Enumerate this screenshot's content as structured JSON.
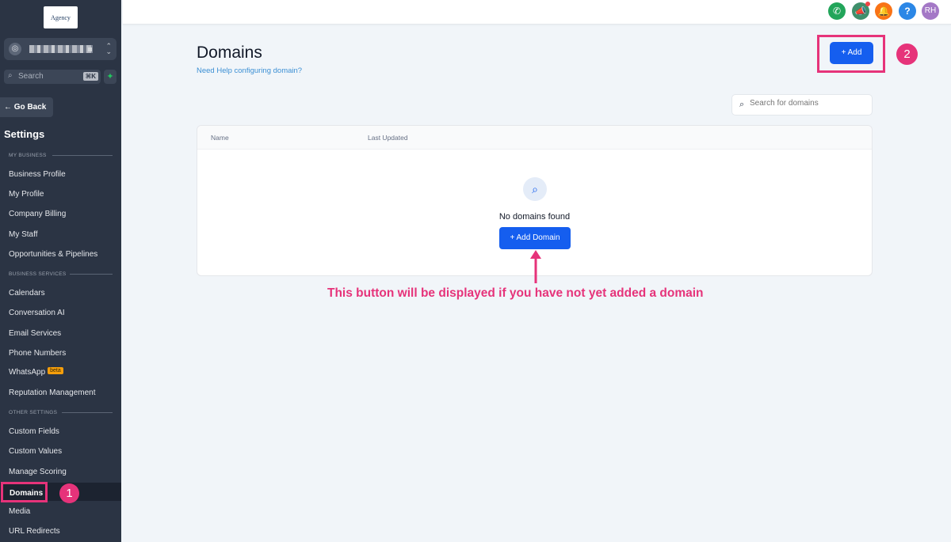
{
  "sidebar": {
    "logo_text": "Agency",
    "search_label": "Search",
    "search_shortcut": "⌘K",
    "go_back": "Go Back",
    "settings_title": "Settings",
    "sections": {
      "my_business": "MY BUSINESS",
      "business_services": "BUSINESS SERVICES",
      "other_settings": "OTHER SETTINGS"
    },
    "items": {
      "business_profile": "Business Profile",
      "my_profile": "My Profile",
      "company_billing": "Company Billing",
      "my_staff": "My Staff",
      "opportunities": "Opportunities & Pipelines",
      "calendars": "Calendars",
      "conversation_ai": "Conversation AI",
      "email_services": "Email Services",
      "phone_numbers": "Phone Numbers",
      "whatsapp": "WhatsApp",
      "whatsapp_badge": "beta",
      "reputation": "Reputation Management",
      "custom_fields": "Custom Fields",
      "custom_values": "Custom Values",
      "manage_scoring": "Manage Scoring",
      "domains": "Domains",
      "media": "Media",
      "url_redirects": "URL Redirects"
    }
  },
  "topbar": {
    "avatar_initials": "RH",
    "help_glyph": "?"
  },
  "main": {
    "title": "Domains",
    "help_link": "Need Help configuring domain?",
    "add_button": "+ Add",
    "search_placeholder": "Search for domains",
    "table": {
      "col_name": "Name",
      "col_updated": "Last Updated"
    },
    "empty_text": "No domains found",
    "add_domain_button": "+ Add Domain"
  },
  "annotations": {
    "badge_1": "1",
    "badge_2": "2",
    "note": "This button will be displayed if you have not yet added a domain"
  },
  "colors": {
    "sidebar_bg": "#2b3444",
    "primary": "#155eef",
    "highlight": "#e6337a",
    "link": "#3b8fd4"
  }
}
